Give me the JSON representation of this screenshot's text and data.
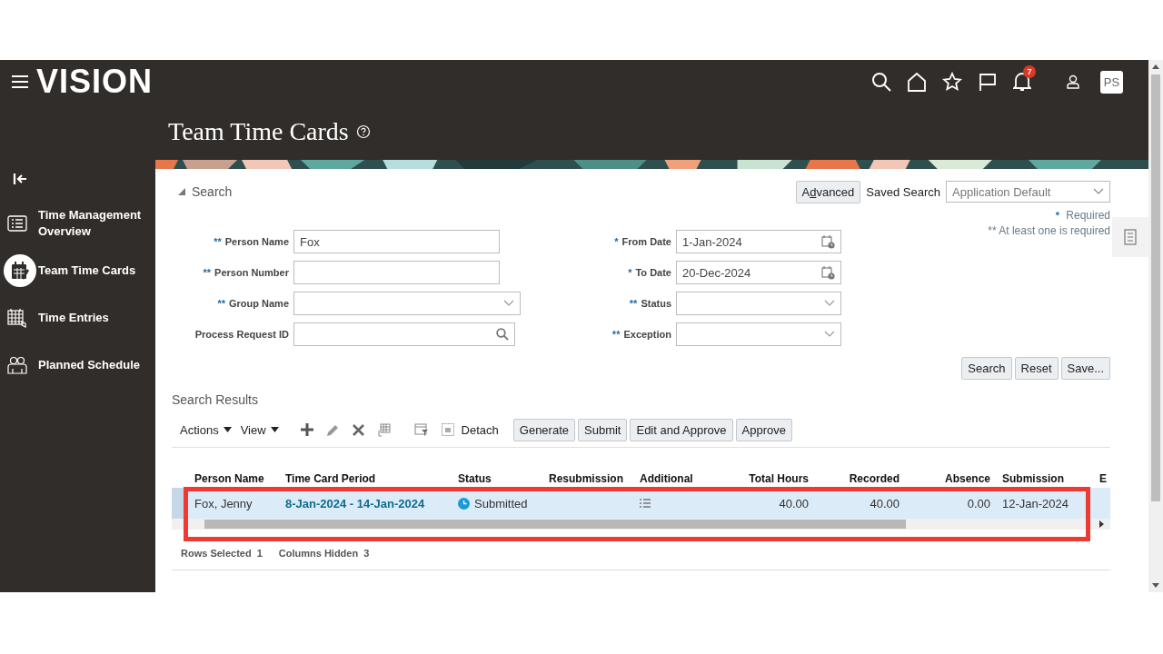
{
  "app": {
    "logo": "VISION",
    "notification_count": "7",
    "user_initials": "PS"
  },
  "page": {
    "title": "Team Time Cards"
  },
  "sidebar": {
    "items": [
      {
        "label": "Time Management Overview",
        "selected": false
      },
      {
        "label": "Team Time Cards",
        "selected": true
      },
      {
        "label": "Time Entries",
        "selected": false
      },
      {
        "label": "Planned Schedule",
        "selected": false
      }
    ]
  },
  "search": {
    "title": "Search",
    "expanded": true,
    "advanced": "Advanced",
    "saved_search_label": "Saved Search",
    "saved_search_value": "Application Default",
    "required_note": "Required",
    "required_marker": "*",
    "at_least_one_note": "** At least one is required",
    "left_fields": [
      {
        "marker": "**",
        "label": "Person Name",
        "kind": "text",
        "value": "Fox"
      },
      {
        "marker": "**",
        "label": "Person Number",
        "kind": "text"
      },
      {
        "marker": "**",
        "label": "Group Name",
        "kind": "select"
      },
      {
        "label": "Process Request ID",
        "kind": "search"
      }
    ],
    "right_fields": [
      {
        "marker": "*",
        "label": "From Date",
        "kind": "date",
        "value": "1-Jan-2024"
      },
      {
        "marker": "*",
        "label": "To Date",
        "kind": "date",
        "value": "20-Dec-2024"
      },
      {
        "marker": "**",
        "label": "Status",
        "kind": "select"
      },
      {
        "marker": "**",
        "label": "Exception",
        "kind": "select"
      }
    ],
    "buttons": [
      "Search",
      "Reset",
      "Save..."
    ]
  },
  "results": {
    "title": "Search Results",
    "menus": [
      "Actions",
      "View"
    ],
    "detach": "Detach",
    "buttons": [
      "Generate",
      "Submit",
      "Edit and Approve",
      "Approve"
    ],
    "columns": [
      "Person Name",
      "Time Card Period",
      "Status",
      "Resubmission",
      "Additional",
      "Total Hours",
      "Recorded",
      "Absence",
      "Submission",
      "E"
    ],
    "rows": [
      {
        "selected": true,
        "person_name": "Fox, Jenny",
        "period": "8-Jan-2024 - 14-Jan-2024",
        "status": "Submitted",
        "total_hours": "40.00",
        "recorded_hours": "40.00",
        "absence_hours": "0.00",
        "submission_date": "12-Jan-2024"
      }
    ],
    "footer": {
      "rows_selected_label": "Rows Selected",
      "rows_selected": "1",
      "columns_hidden_label": "Columns Hidden",
      "columns_hidden": "3"
    }
  }
}
